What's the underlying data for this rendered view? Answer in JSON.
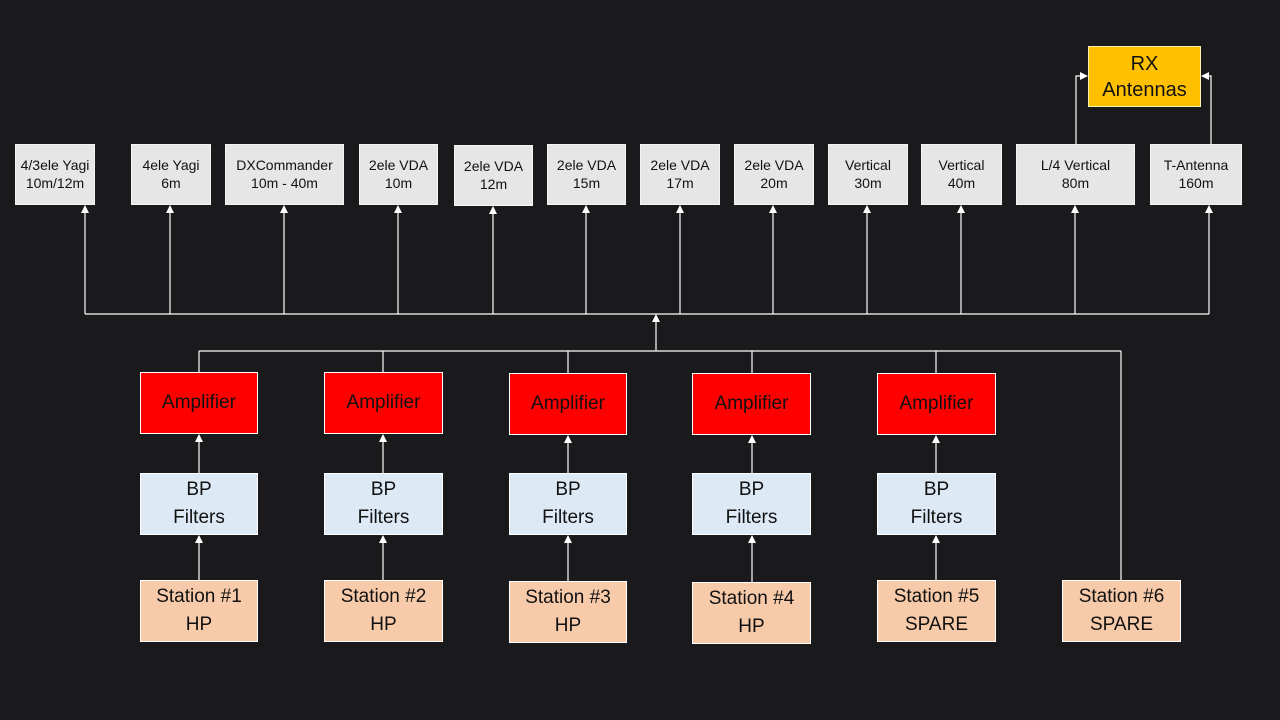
{
  "colors": {
    "background": "#1a1a1c",
    "antenna": "#e6e6e6",
    "rx": "#ffc000",
    "amplifier": "#ff0000",
    "filter": "#dde9f5",
    "station": "#f7cbaa",
    "wire": "#ffffff"
  },
  "rx": {
    "line1": "RX",
    "line2": "Antennas"
  },
  "antennas": [
    {
      "line1": "4/3ele Yagi",
      "line2": "10m/12m"
    },
    {
      "line1": "4ele Yagi",
      "line2": "6m"
    },
    {
      "line1": "DXCommander",
      "line2": "10m - 40m"
    },
    {
      "line1": "2ele VDA",
      "line2": "10m"
    },
    {
      "line1": "2ele VDA",
      "line2": "12m"
    },
    {
      "line1": "2ele VDA",
      "line2": "15m"
    },
    {
      "line1": "2ele VDA",
      "line2": "17m"
    },
    {
      "line1": "2ele VDA",
      "line2": "20m"
    },
    {
      "line1": "Vertical",
      "line2": "30m"
    },
    {
      "line1": "Vertical",
      "line2": "40m"
    },
    {
      "line1": "L/4 Vertical",
      "line2": "80m"
    },
    {
      "line1": "T-Antenna",
      "line2": "160m"
    }
  ],
  "amplifier_label": "Amplifier",
  "filter": {
    "line1": "BP",
    "line2": "Filters"
  },
  "stations": [
    {
      "line1": "Station #1",
      "line2": "HP"
    },
    {
      "line1": "Station #2",
      "line2": "HP"
    },
    {
      "line1": "Station #3",
      "line2": "HP"
    },
    {
      "line1": "Station #4",
      "line2": "HP"
    },
    {
      "line1": "Station #5",
      "line2": "SPARE"
    },
    {
      "line1": "Station #6",
      "line2": "SPARE"
    }
  ]
}
